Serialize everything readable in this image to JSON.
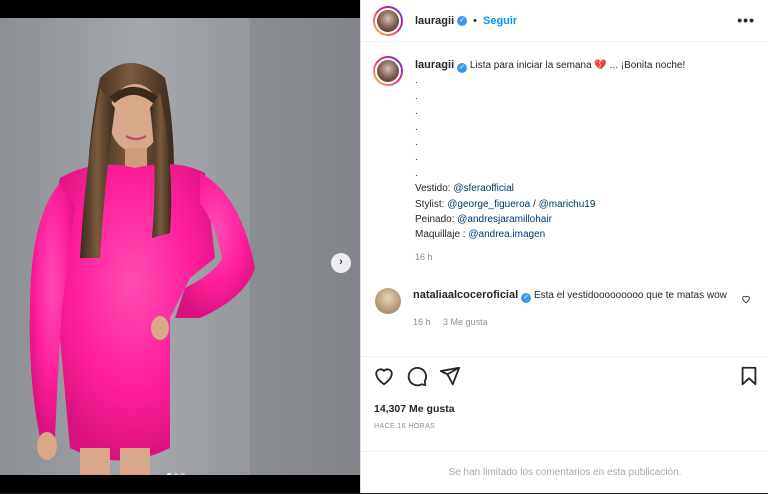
{
  "post": {
    "author": "lauragii",
    "follow_label": "Seguir",
    "more_label": "•••",
    "dot": "•"
  },
  "caption": {
    "author": "lauragii",
    "line1_text": "Lista para iniciar la semana",
    "emoji": "💔",
    "line1_end": " ... ¡Bonita noche!",
    "dots": [
      ".",
      ".",
      ".",
      ".",
      ".",
      ".",
      "."
    ],
    "vestido_label": "Vestido: ",
    "vestido_mention": "@sferaofficial",
    "stylist_label": "Stylist: ",
    "stylist_mention1": "@george_figueroa",
    "stylist_sep": " / ",
    "stylist_mention2": "@marichu19",
    "peinado_label": "Peinado: ",
    "peinado_mention": "@andresjaramillohair",
    "maquillaje_label": "Maquillaje : ",
    "maquillaje_mention": "@andrea.imagen",
    "time": "16 h"
  },
  "comment": {
    "author": "nataliaalcoceroficial",
    "text": "Esta el vestidooooooooo que te matas wow",
    "time": "16 h",
    "likes": "3 Me gusta"
  },
  "stats": {
    "likes": "14,307 Me gusta",
    "timeago": "HACE 16 HORAS"
  },
  "footer": {
    "limited_text": "Se han limitado los comentarios en esta publicación."
  },
  "carousel": {
    "next_label": "›",
    "slides": 3,
    "active": 1
  },
  "colors": {
    "accent": "#0095f6",
    "verified": "#3897f0",
    "dress": "#ff1f9a",
    "mention": "#00376b"
  },
  "icons": [
    "heart-icon",
    "comment-icon",
    "share-icon",
    "bookmark-icon",
    "more-icon",
    "verified-icon",
    "chevron-right-icon"
  ]
}
